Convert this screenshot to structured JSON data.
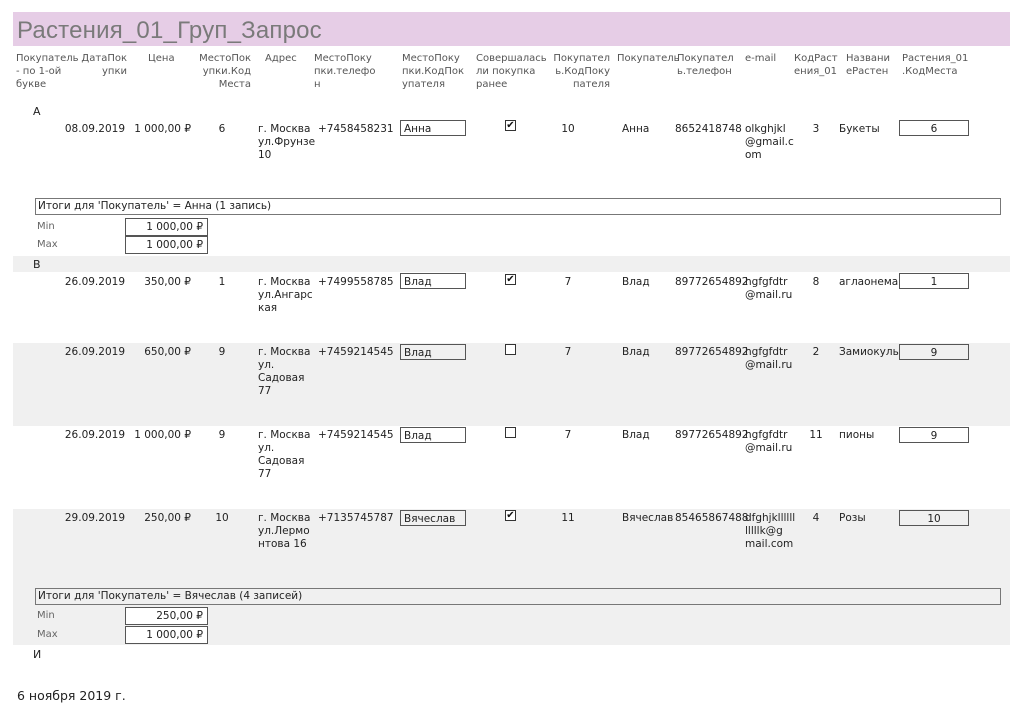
{
  "report_title": "Растения_01_Груп_Запрос",
  "headers": {
    "h_group": "Покупатель\n- по 1-ой\nбукве",
    "h_date": "ДатаПок\nупки",
    "h_price": "Цена",
    "h_place_code": "МестоПок\nупки.Код\nМеста",
    "h_address": "Адрес",
    "h_place_phone": "МестоПоку\nпки.телефо\nн",
    "h_place_buyer_code": "МестоПоку\nпки.КодПок\nупателя",
    "h_prev_purchase": "Совершалась\nли покупка\nранее",
    "h_buyer_code": "Покупател\nь.КодПоку\nпателя",
    "h_buyer": "Покупатель",
    "h_buyer_phone": "Покупател\nь.телефон",
    "h_email": "e-mail",
    "h_plant_code": "КодРаст\nения_01",
    "h_plant_name": "Названи\nеРастен",
    "h_plant_place": "Растения_01\n.КодМеста"
  },
  "group_a": {
    "letter": "А",
    "row1": {
      "date": "08.09.2019",
      "price": "1 000,00 ₽",
      "place_code": "6",
      "address": "г. Москва\nул.Фрунзе\n10",
      "place_phone": "+7458458231",
      "place_buyer": "Анна",
      "prev_purchase": true,
      "buyer_code": "10",
      "buyer": "Анна",
      "buyer_phone": "8652418748",
      "email": "olkghjkl\n@gmail.c\nom",
      "plant_code": "3",
      "plant_name": "Букеты",
      "plant_place": "6"
    },
    "summary": "Итоги для 'Покупатель' =  Анна (1 запись)",
    "min_label": "Min",
    "min_value": "1 000,00 ₽",
    "max_label": "Max",
    "max_value": "1 000,00 ₽"
  },
  "group_b": {
    "letter": "В",
    "row1": {
      "date": "26.09.2019",
      "price": "350,00 ₽",
      "place_code": "1",
      "address": "г. Москва\nул.Ангарс\nкая",
      "place_phone": "+7499558785",
      "place_buyer": "Влад",
      "prev_purchase": true,
      "buyer_code": "7",
      "buyer": "Влад",
      "buyer_phone": "89772654892",
      "email": "hgfgfdtr\n@mail.ru",
      "plant_code": "8",
      "plant_name": "аглаонема",
      "plant_place": "1"
    },
    "row2": {
      "date": "26.09.2019",
      "price": "650,00 ₽",
      "place_code": "9",
      "address": "г. Москва\nул.\nСадовая\n77",
      "place_phone": "+7459214545",
      "place_buyer": "Влад",
      "prev_purchase": false,
      "buyer_code": "7",
      "buyer": "Влад",
      "buyer_phone": "89772654892",
      "email": "hgfgfdtr\n@mail.ru",
      "plant_code": "2",
      "plant_name": "Замиокулькас",
      "plant_place": "9"
    },
    "row3": {
      "date": "26.09.2019",
      "price": "1 000,00 ₽",
      "place_code": "9",
      "address": "г. Москва\nул.\nСадовая\n77",
      "place_phone": "+7459214545",
      "place_buyer": "Влад",
      "prev_purchase": false,
      "buyer_code": "7",
      "buyer": "Влад",
      "buyer_phone": "89772654892",
      "email": "hgfgfdtr\n@mail.ru",
      "plant_code": "11",
      "plant_name": "пионы",
      "plant_place": "9"
    },
    "row4": {
      "date": "29.09.2019",
      "price": "250,00 ₽",
      "place_code": "10",
      "address": "г. Москва\nул.Лермо\nнтова 16",
      "place_phone": "+7135745787",
      "place_buyer": "Вячеслав",
      "prev_purchase": true,
      "buyer_code": "11",
      "buyer": "Вячеслав",
      "buyer_phone": "85465867488",
      "email": "dfghjkllllll\nlllllk@g\nmail.com",
      "plant_code": "4",
      "plant_name": "Розы",
      "plant_place": "10"
    },
    "summary": "Итоги для 'Покупатель' =  Вячеслав (4 записей)",
    "min_label": "Min",
    "min_value": "250,00 ₽",
    "max_label": "Max",
    "max_value": "1 000,00 ₽"
  },
  "group_i": {
    "letter": "И"
  },
  "footer_date": "6 ноября 2019 г."
}
